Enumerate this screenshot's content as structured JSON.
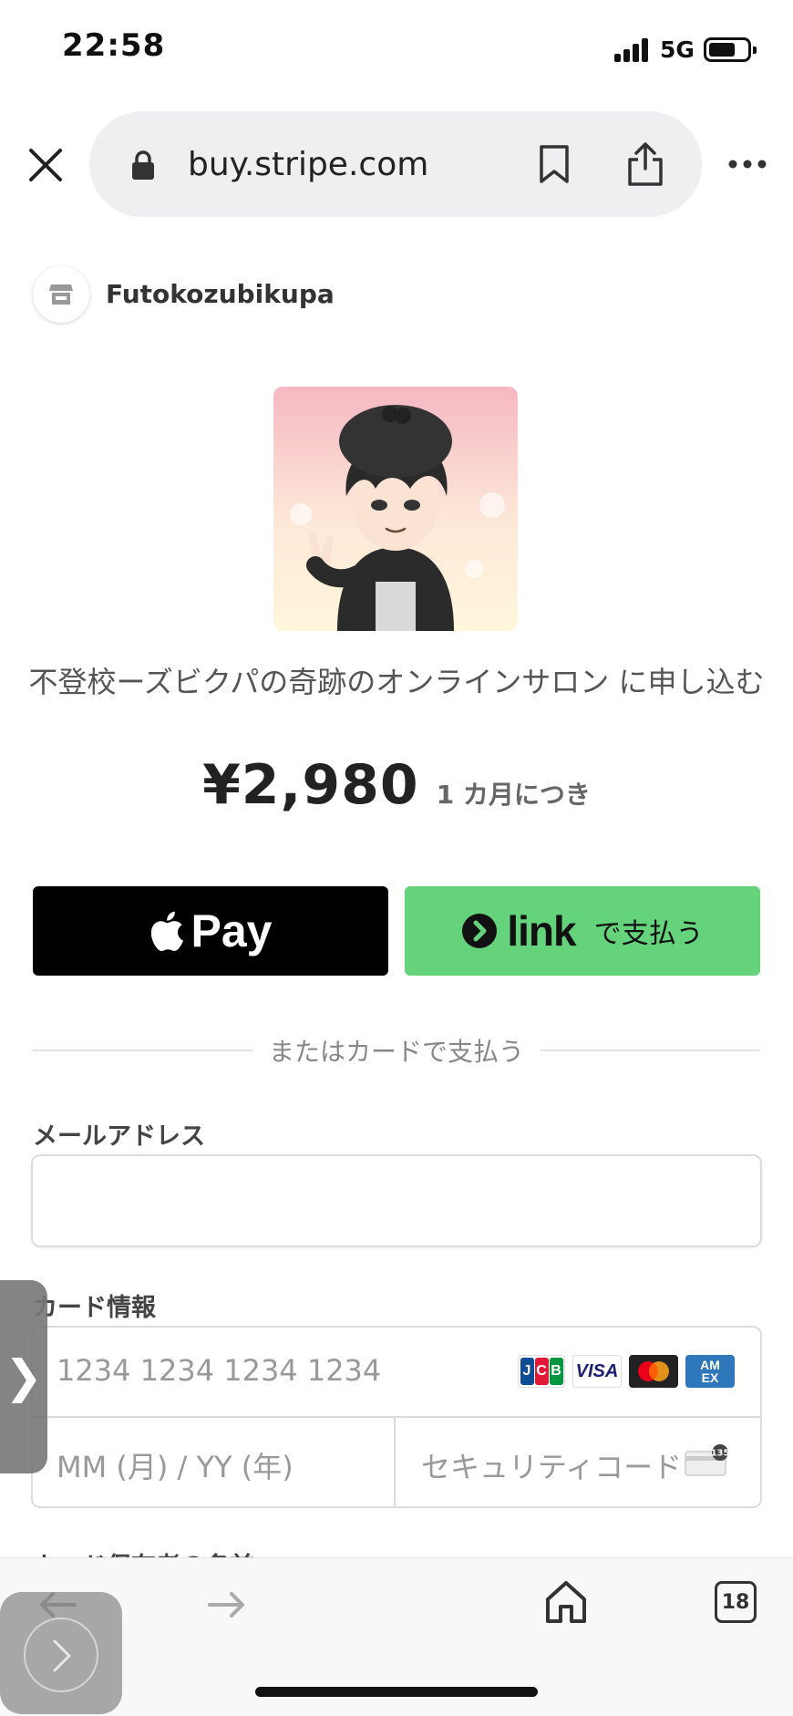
{
  "status_bar": {
    "time": "22:58",
    "network": "5G"
  },
  "browser": {
    "url": "buy.stripe.com",
    "tab_count": "18"
  },
  "merchant": {
    "name": "Futokozubikupa"
  },
  "product": {
    "title": "不登校ーズビクパの奇跡のオンラインサロン に申し込む",
    "price": "¥2,980",
    "interval": "1 カ月につき"
  },
  "buttons": {
    "apple_pay": "Pay",
    "link_word": "link",
    "link_suffix": "で支払う"
  },
  "divider_text": "またはカードで支払う",
  "form": {
    "email_label": "メールアドレス",
    "email_value": "",
    "card_label": "カード情報",
    "card_number_placeholder": "1234 1234 1234 1234",
    "expiry_placeholder": "MM (月) / YY (年)",
    "cvc_placeholder": "セキュリティコード",
    "cvc_badge": "135",
    "cardholder_label": "カード保有者の名前"
  },
  "card_brands": [
    "JCB",
    "VISA",
    "Mastercard",
    "AMEX"
  ],
  "colors": {
    "link_green": "#64d37c",
    "apple_black": "#000000"
  }
}
